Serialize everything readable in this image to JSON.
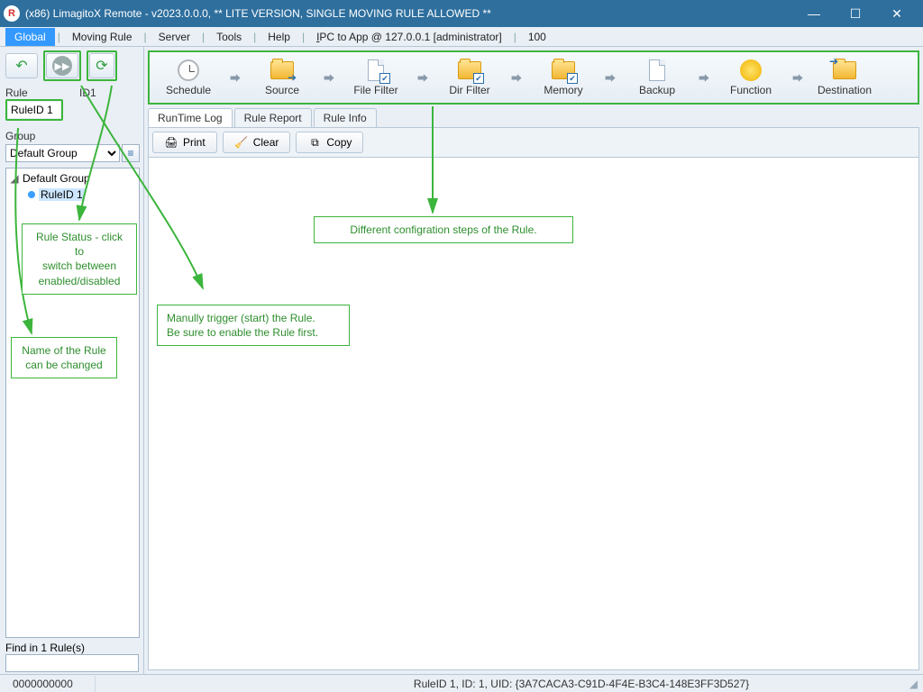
{
  "window": {
    "title": "(x86) LimagitoX Remote - v2023.0.0.0,  ** LITE VERSION, SINGLE MOVING RULE ALLOWED **"
  },
  "menu": {
    "global": "Global",
    "moving_rule": "Moving Rule",
    "server": "Server",
    "tools": "Tools",
    "help": "Help",
    "ipc": "IPC to App @ 127.0.0.1 [administrator]",
    "count": "100"
  },
  "left": {
    "rule_label": "Rule",
    "id_label": "ID1",
    "rule_value": "RuleID 1",
    "group_label": "Group",
    "group_value": "Default Group",
    "tree_root": "Default Group",
    "tree_child": "RuleID 1",
    "find_label": "Find in 1 Rule(s)",
    "find_value": ""
  },
  "config_steps": {
    "schedule": "Schedule",
    "source": "Source",
    "file_filter": "File Filter",
    "dir_filter": "Dir Filter",
    "memory": "Memory",
    "backup": "Backup",
    "function": "Function",
    "destination": "Destination"
  },
  "tabs": {
    "runtime": "RunTime Log",
    "report": "Rule Report",
    "info": "Rule Info"
  },
  "log_toolbar": {
    "print": "Print",
    "clear": "Clear",
    "copy": "Copy"
  },
  "status": {
    "left": "0000000000",
    "middle": "RuleID 1, ID: 1, UID: {3A7CACA3-C91D-4F4E-B3C4-148E3FF3D527}"
  },
  "annotations": {
    "steps": "Different configration steps of the Rule.",
    "trigger": "Manully trigger (start) the Rule.\nBe sure to enable the Rule first.",
    "status": "Rule Status - click to\nswitch between\nenabled/disabled",
    "name": "Name of the Rule\ncan be changed"
  }
}
